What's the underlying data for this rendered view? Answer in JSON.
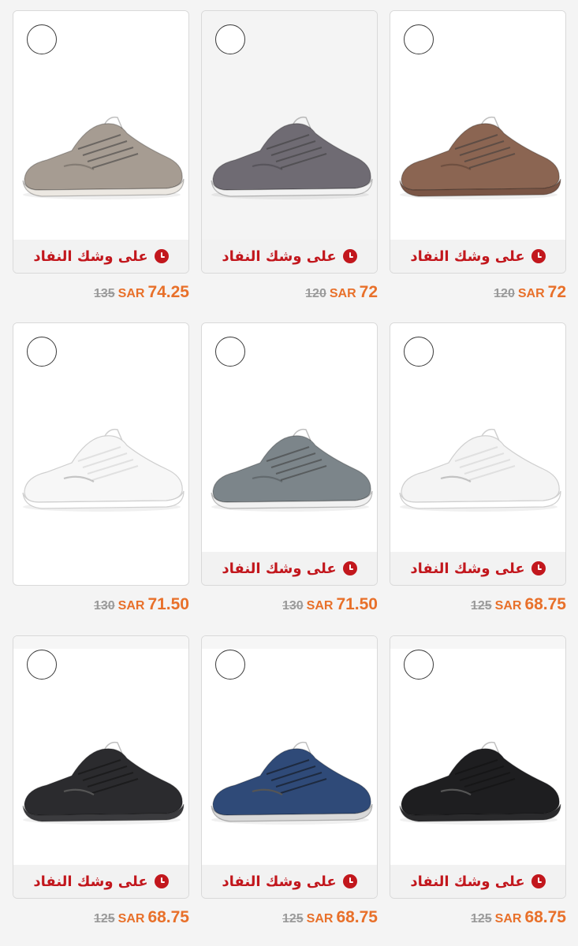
{
  "badge_text": "على وشك النفاد",
  "products": [
    {
      "name": "brown-knit-sneaker",
      "old_price": "120",
      "currency": "SAR",
      "price": "72",
      "shoe_color": "#8b6552",
      "sole_color": "#7a5545",
      "img_bg": "white"
    },
    {
      "name": "gray-mesh-sneaker",
      "old_price": "120",
      "currency": "SAR",
      "price": "72",
      "shoe_color": "#6f6b73",
      "sole_color": "#f2f2f2",
      "img_bg": "gray"
    },
    {
      "name": "taupe-sneaker",
      "old_price": "135",
      "currency": "SAR",
      "price": "74.25",
      "shoe_color": "#a69c92",
      "sole_color": "#ece8e2",
      "img_bg": "white"
    },
    {
      "name": "white-knit-sneaker",
      "old_price": "125",
      "currency": "SAR",
      "price": "68.75",
      "shoe_color": "#f4f4f4",
      "sole_color": "#ffffff",
      "img_bg": "white"
    },
    {
      "name": "gray-teal-knit-sneaker",
      "old_price": "130",
      "currency": "SAR",
      "price": "71.50",
      "shoe_color": "#7c858a",
      "sole_color": "#f1f1f1",
      "img_bg": "white"
    },
    {
      "name": "white-slip-on",
      "old_price": "130",
      "currency": "SAR",
      "price": "71.50",
      "shoe_color": "#f7f7f7",
      "sole_color": "#ffffff",
      "img_bg": "white",
      "no_badge": true
    },
    {
      "name": "black-knit-sneaker",
      "old_price": "125",
      "currency": "SAR",
      "price": "68.75",
      "shoe_color": "#1e1e20",
      "sole_color": "#2a2a2c",
      "img_bg": "topgray"
    },
    {
      "name": "navy-runner",
      "old_price": "125",
      "currency": "SAR",
      "price": "68.75",
      "shoe_color": "#2f4a78",
      "sole_color": "#d9d9d9",
      "img_bg": "topgray"
    },
    {
      "name": "black-leather-sneaker",
      "old_price": "125",
      "currency": "SAR",
      "price": "68.75",
      "shoe_color": "#2b2b2e",
      "sole_color": "#3b3b3e",
      "img_bg": "topgray"
    }
  ],
  "colors": {
    "badge_red": "#c2171d",
    "price_orange": "#e8702a",
    "old_price_gray": "#9a9a9a"
  },
  "icons": {
    "select": "circle-outline-icon",
    "badge": "clock-icon"
  }
}
